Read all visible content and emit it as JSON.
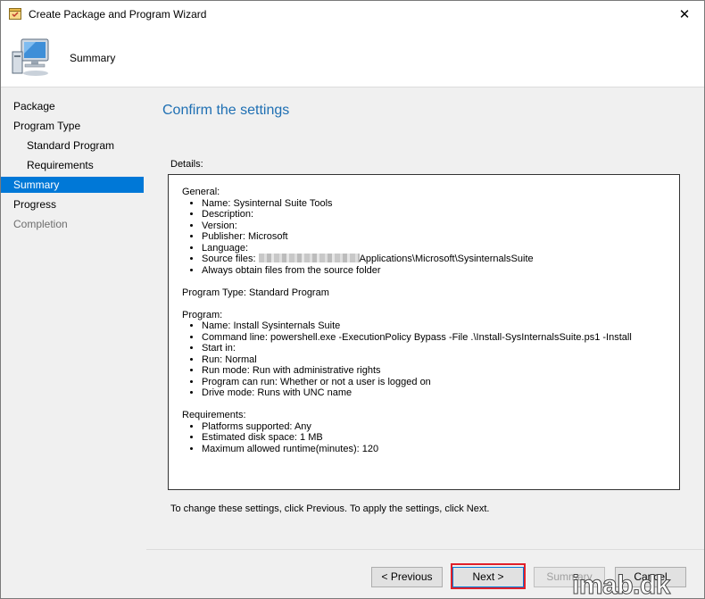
{
  "window": {
    "title": "Create Package and Program Wizard",
    "close_glyph": "✕"
  },
  "header": {
    "title": "Summary"
  },
  "nav": {
    "items": [
      {
        "label": "Package",
        "level": 0,
        "state": "normal"
      },
      {
        "label": "Program Type",
        "level": 0,
        "state": "normal"
      },
      {
        "label": "Standard Program",
        "level": 1,
        "state": "normal"
      },
      {
        "label": "Requirements",
        "level": 1,
        "state": "normal"
      },
      {
        "label": "Summary",
        "level": 0,
        "state": "active"
      },
      {
        "label": "Progress",
        "level": 0,
        "state": "normal"
      },
      {
        "label": "Completion",
        "level": 0,
        "state": "disabled"
      }
    ]
  },
  "main": {
    "heading": "Confirm the settings",
    "details_label": "Details:",
    "details": {
      "general_title": "General:",
      "general_items": [
        "Name: Sysinternal Suite Tools",
        "Description:",
        "Version:",
        "Publisher: Microsoft",
        "Language:"
      ],
      "source_prefix": "Source files: ",
      "source_suffix": "Applications\\Microsoft\\SysinternalsSuite",
      "always_obtain": "Always obtain files from the source folder",
      "program_type": "Program Type: Standard Program",
      "program_title": "Program:",
      "program_items": [
        "Name: Install Sysinternals Suite",
        "Command line: powershell.exe -ExecutionPolicy Bypass -File .\\Install-SysInternalsSuite.ps1 -Install",
        "Start in:",
        "Run: Normal",
        "Run mode: Run with administrative rights",
        "Program can run: Whether or not a user is logged on",
        "Drive mode: Runs with UNC name"
      ],
      "requirements_title": "Requirements:",
      "requirements_items": [
        "Platforms supported: Any",
        "Estimated disk space: 1 MB",
        "Maximum allowed runtime(minutes): 120"
      ]
    },
    "footer_text": "To change these settings, click Previous. To apply the settings, click Next."
  },
  "buttons": {
    "previous": "< Previous",
    "next": "Next >",
    "summary": "Summary",
    "cancel": "Cancel"
  },
  "watermark": "imab.dk",
  "colors": {
    "accent": "#0078d7",
    "heading": "#1e6fb3",
    "highlight_border": "#e0202a"
  }
}
